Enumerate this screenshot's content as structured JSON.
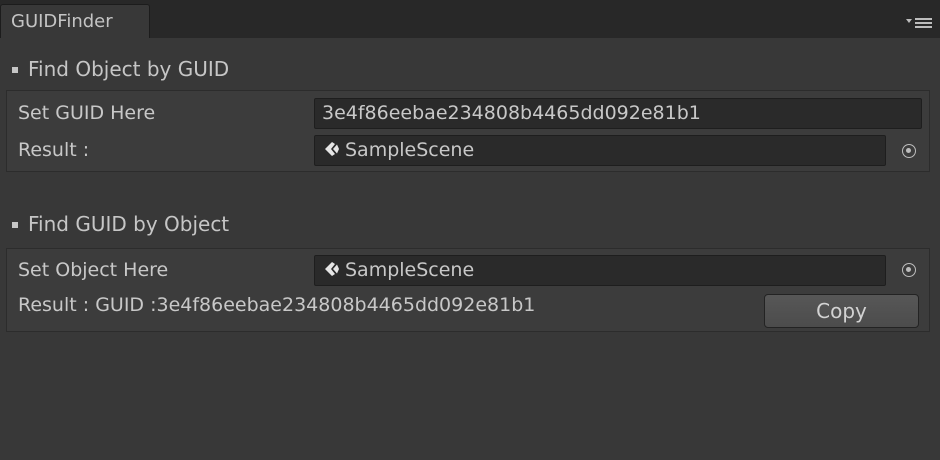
{
  "window": {
    "tab_title": "GUIDFinder",
    "menu_icon": "tab-options-icon"
  },
  "find_object": {
    "title": "Find Object by GUID",
    "guid_label": "Set GUID Here",
    "guid_value": "3e4f86eebae234808b4465dd092e81b1",
    "result_label": "Result :",
    "result_value": "SampleScene",
    "result_icon": "unity-logo-icon"
  },
  "find_guid": {
    "title": "Find GUID by Object",
    "object_label": "Set Object Here",
    "object_value": "SampleScene",
    "object_icon": "unity-logo-icon",
    "result_text": "Result : GUID :3e4f86eebae234808b4465dd092e81b1",
    "copy_label": "Copy"
  },
  "colors": {
    "background": "#383838",
    "panel": "#3c3c3c",
    "field": "#2a2a2a",
    "text": "#c8c8c8"
  }
}
